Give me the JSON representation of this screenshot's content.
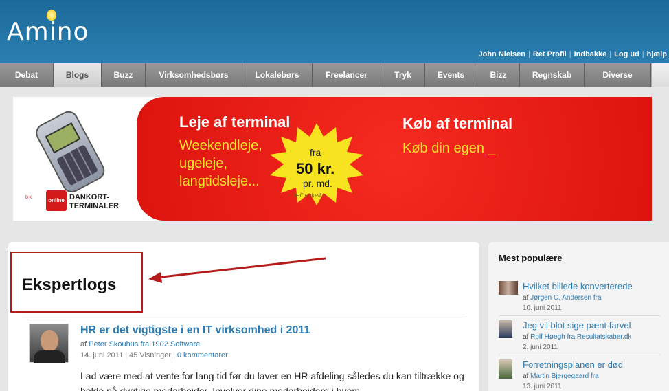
{
  "header": {
    "logo": "Amino",
    "user_nav": [
      "John Nielsen",
      "Ret Profil",
      "Indbakke",
      "Log ud",
      "hjælp"
    ]
  },
  "nav": {
    "tabs": [
      "Debat",
      "Blogs",
      "Buzz",
      "Virksomhedsbørs",
      "Lokalebørs",
      "Freelancer",
      "Tryk",
      "Events",
      "Bizz",
      "Regnskab",
      "Diverse"
    ],
    "active": "Blogs"
  },
  "banner": {
    "brand_line1": "DANKORT-",
    "brand_line2": "TERMINALER",
    "brand_box": "online",
    "brand_dots": "DK",
    "left_heading": "Leje af terminal",
    "left_lines": [
      "Weekendleje,",
      "ugeleje,",
      "langtidsleje..."
    ],
    "star_fra": "fra",
    "star_price": "50 kr.",
    "star_unit": "pr. md.",
    "star_note": "- helt enkelt -",
    "right_heading": "Køb af terminal",
    "right_line": "Køb din egen _"
  },
  "main": {
    "page_title": "Ekspertlogs",
    "post": {
      "title": "HR er det vigtigste i en IT virksomhed i 2011",
      "by_prefix": "af",
      "author": "Peter Skouhus fra 1902 Software",
      "date": "14. juni 2011",
      "views": "45 Visninger",
      "comments": "0 kommentarer",
      "body": "Lad være med at vente for lang tid før du laver en HR afdeling således du kan tiltrække og holde på dygtige medarbeider. Involver dine medarbeidere i hvem"
    }
  },
  "sidebar": {
    "title": "Mest populære",
    "items": [
      {
        "title": "Hvilket billede konverterede",
        "by_prefix": "af",
        "author": "Jørgen C. Andersen fra",
        "date": "10. juni 2011"
      },
      {
        "title": "Jeg vil blot sige pænt farvel",
        "by_prefix": "af",
        "author": "Rolf Høegh fra Resultatskaber.dk",
        "date": "2. juni 2011"
      },
      {
        "title": "Forretningsplanen er død",
        "by_prefix": "af",
        "author": "Martin Bjergegaard fra",
        "date": "13. juni 2011"
      }
    ]
  },
  "colors": {
    "header_blue": "#2a7fb0",
    "link_blue": "#2d7bb0",
    "banner_red": "#e81c14",
    "banner_yellow": "#f5e62a",
    "callout_red": "#b71c1c"
  }
}
